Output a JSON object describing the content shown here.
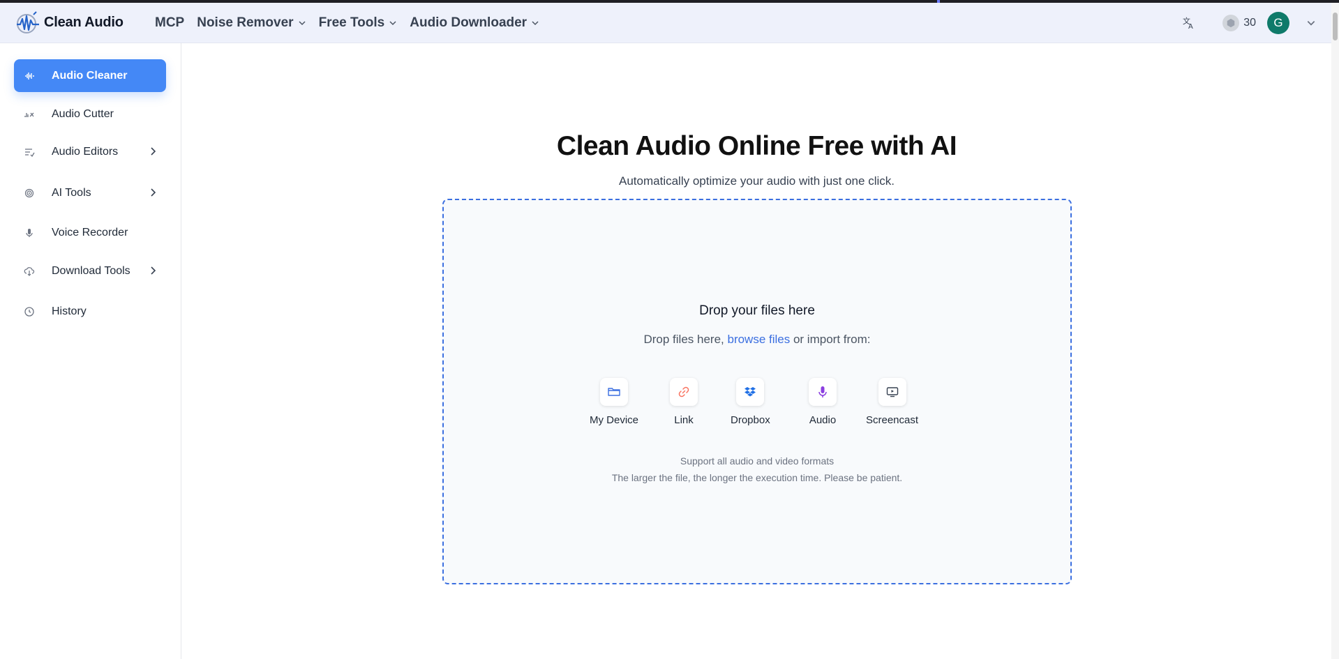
{
  "header": {
    "logo_text": "Clean Audio",
    "nav": [
      {
        "label": "MCP",
        "dropdown": false
      },
      {
        "label": "Noise Remover",
        "dropdown": true
      },
      {
        "label": "Free Tools",
        "dropdown": true
      },
      {
        "label": "Audio Downloader",
        "dropdown": true
      }
    ],
    "credits": "30",
    "avatar_letter": "G"
  },
  "sidebar": {
    "items": [
      {
        "label": "Audio Cleaner",
        "icon": "waveform-icon",
        "active": true
      },
      {
        "label": "Audio Cutter",
        "icon": "audio-cut-icon"
      },
      {
        "label": "Audio Editors",
        "icon": "list-edit-icon",
        "expandable": true
      },
      {
        "label": "AI Tools",
        "icon": "ai-chip-icon",
        "expandable": true
      },
      {
        "label": "Voice Recorder",
        "icon": "microphone-icon"
      },
      {
        "label": "Download Tools",
        "icon": "cloud-download-icon",
        "expandable": true
      },
      {
        "label": "History",
        "icon": "clock-icon"
      }
    ]
  },
  "main": {
    "title": "Clean Audio Online Free with AI",
    "subtitle": "Automatically optimize your audio with just one click.",
    "drop": {
      "heading": "Drop your files here",
      "line_prefix": "Drop files here, ",
      "browse_link": "browse files",
      "line_suffix": " or import from:",
      "sources": [
        {
          "label": "My Device",
          "icon": "folder-icon",
          "color": "#3b6fe0"
        },
        {
          "label": "Link",
          "icon": "link-icon",
          "color": "#f97360"
        },
        {
          "label": "Dropbox",
          "icon": "dropbox-icon",
          "color": "#1f6fe5"
        },
        {
          "label": "Audio",
          "icon": "microphone-icon",
          "color": "#8b3fe0"
        },
        {
          "label": "Screencast",
          "icon": "screencast-icon",
          "color": "#374151"
        }
      ],
      "note1": "Support all audio and video formats",
      "note2": "The larger the file, the longer the execution time. Please be patient."
    }
  },
  "colors": {
    "accent": "#4488f6",
    "dashed_border": "#3b6fe0",
    "avatar": "#0f7a6a"
  }
}
